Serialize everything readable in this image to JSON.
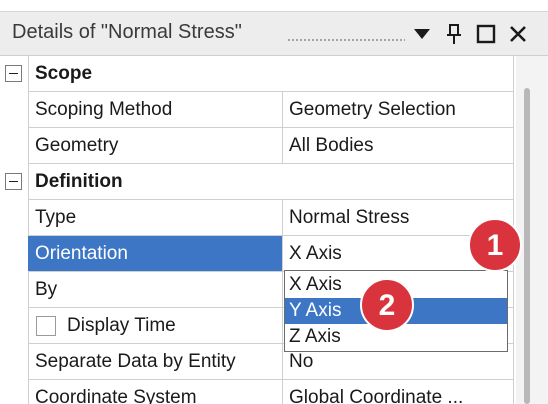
{
  "panel": {
    "title": "Details of \"Normal Stress\""
  },
  "groups": {
    "scope": {
      "label": "Scope",
      "rows": [
        {
          "name": "Scoping Method",
          "value": "Geometry Selection"
        },
        {
          "name": "Geometry",
          "value": "All Bodies"
        }
      ]
    },
    "definition": {
      "label": "Definition",
      "rows": [
        {
          "name": "Type",
          "value": "Normal Stress"
        },
        {
          "name": "Orientation",
          "value": "X Axis"
        },
        {
          "name": "By",
          "value": ""
        },
        {
          "name": "Display Time",
          "value": ""
        },
        {
          "name": "Separate Data by Entity",
          "value": "No"
        },
        {
          "name": "Coordinate System",
          "value": "Global Coordinate ..."
        }
      ]
    }
  },
  "orientation_dropdown": {
    "options": [
      "X Axis",
      "Y Axis",
      "Z Axis"
    ],
    "highlighted": "Y Axis"
  },
  "callouts": [
    "1",
    "2"
  ],
  "colors": {
    "selection_blue": "#3c76c4",
    "callout_red": "#d9343e",
    "titlebar_gray": "#ededed"
  }
}
